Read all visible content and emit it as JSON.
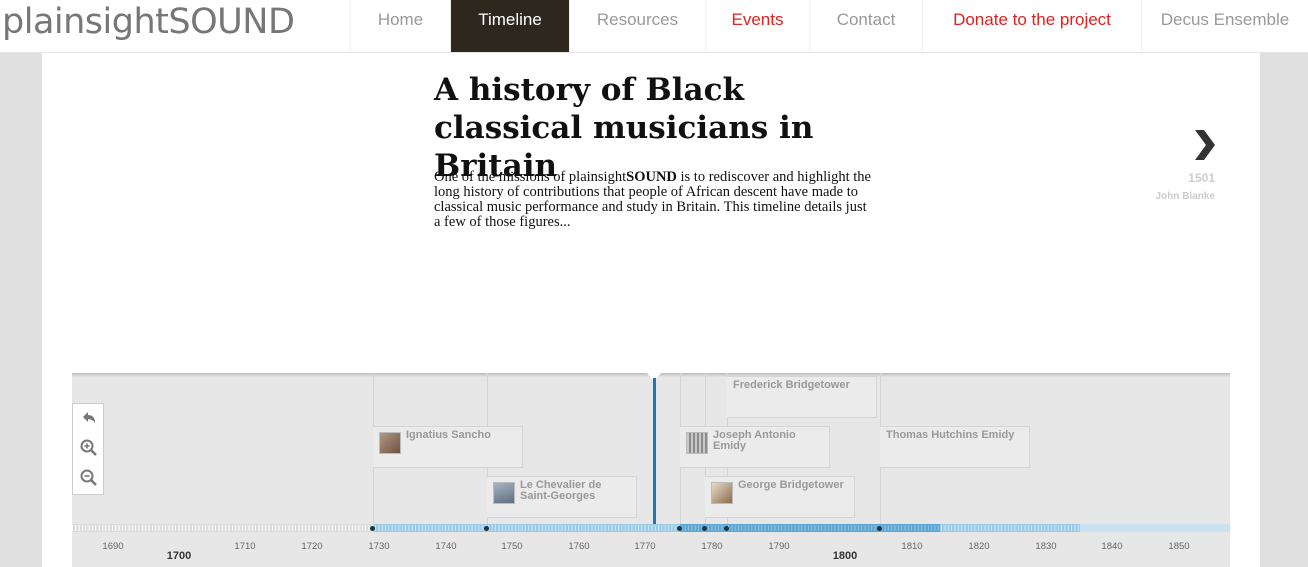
{
  "site": {
    "logo": "plainsightSOUND"
  },
  "nav": [
    {
      "label": "Home",
      "state": ""
    },
    {
      "label": "Timeline",
      "state": "active"
    },
    {
      "label": "Resources",
      "state": ""
    },
    {
      "label": "Events",
      "state": "red"
    },
    {
      "label": "Contact",
      "state": ""
    },
    {
      "label": "Donate to the project",
      "state": "red"
    },
    {
      "label": "Decus Ensemble",
      "state": ""
    }
  ],
  "slide": {
    "title": "A history of Black classical musicians in Britain",
    "intro_before": "One of the missions of plainsight",
    "intro_bold": "SOUND",
    "intro_after": " is to rediscover and highlight the long history of contributions that people of African descent have made to classical music performance and study in Britain. This timeline details just a few of those figures..."
  },
  "next_slide": {
    "year": "1501",
    "name": "John Blanke",
    "icon": "chevron-right-icon"
  },
  "timeline": {
    "controls": [
      "back-to-start-icon",
      "zoom-in-icon",
      "zoom-out-icon"
    ],
    "events": [
      {
        "name": "Ignatius Sancho",
        "year": 1729,
        "row": 1,
        "has_thumb": true
      },
      {
        "name": "Le Chevalier de Saint-Georges",
        "year": 1746,
        "row": 2,
        "has_thumb": true
      },
      {
        "name": "Joseph Antonio Emidy",
        "year": 1775,
        "row": 1,
        "has_thumb": true
      },
      {
        "name": "George Bridgetower",
        "year": 1779,
        "row": 2,
        "has_thumb": true
      },
      {
        "name": "Frederick Bridgetower",
        "year": 1782,
        "row": 0,
        "has_thumb": false
      },
      {
        "name": "Thomas Hutchins Emidy",
        "year": 1805,
        "row": 1,
        "has_thumb": false
      }
    ],
    "minor_ticks": [
      "1690",
      "1710",
      "1720",
      "1730",
      "1740",
      "1750",
      "1760",
      "1770",
      "1780",
      "1790",
      "1810",
      "1820",
      "1830",
      "1840",
      "1850"
    ],
    "major_ticks": [
      "1700",
      "1800"
    ],
    "current_year": 1771,
    "colors": {
      "accent": "#1a78b8",
      "nav_active_bg": "#2e271e",
      "nav_red": "#dd2222"
    }
  }
}
